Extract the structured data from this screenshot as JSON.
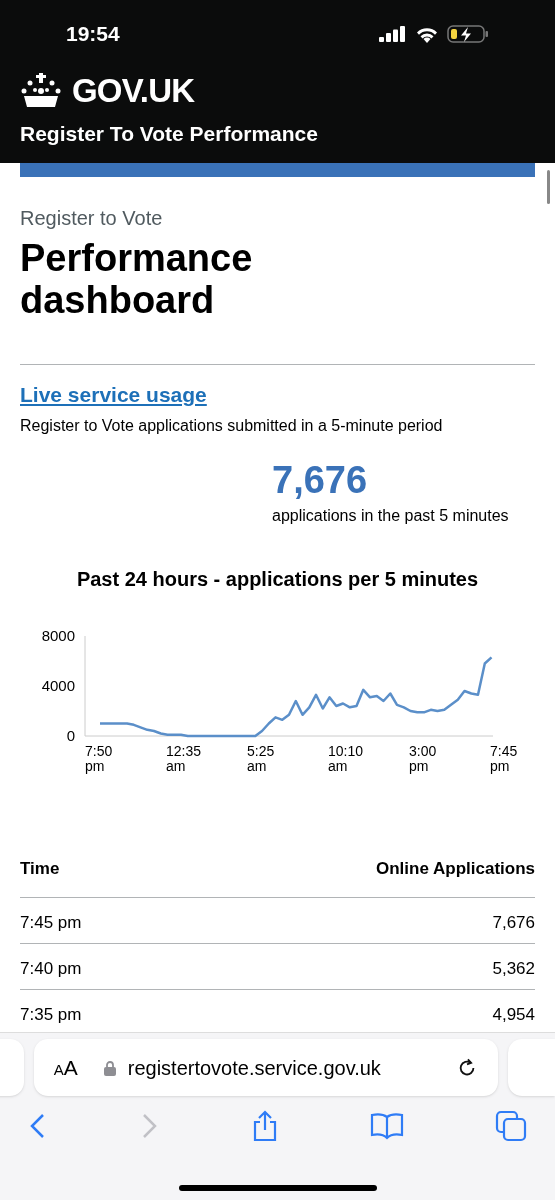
{
  "status_bar": {
    "time": "19:54"
  },
  "header": {
    "logo": "GOV.UK",
    "service": "Register To Vote Performance"
  },
  "page": {
    "caption": "Register to Vote",
    "title": "Performance dashboard"
  },
  "live": {
    "link": "Live service usage",
    "description": "Register to Vote applications submitted in a 5-minute period",
    "figure": "7,676",
    "figure_label": "applications in the past 5 minutes"
  },
  "chart": {
    "chart_data": {
      "type": "line",
      "title": "Past 24 hours - applications per 5 minutes",
      "ylim": [
        0,
        8000
      ],
      "yticks": [
        0,
        4000,
        8000
      ],
      "categories": [
        "7:50 pm",
        null,
        null,
        null,
        null,
        null,
        null,
        null,
        null,
        null,
        null,
        null,
        "12:35 am",
        null,
        null,
        null,
        null,
        null,
        null,
        null,
        null,
        null,
        null,
        null,
        "5:25 am",
        null,
        null,
        null,
        null,
        null,
        null,
        null,
        null,
        null,
        null,
        null,
        "10:10 am",
        null,
        null,
        null,
        null,
        null,
        null,
        null,
        null,
        null,
        null,
        null,
        "3:00 pm",
        null,
        null,
        null,
        null,
        null,
        null,
        null,
        null,
        null,
        null,
        null,
        "7:45 pm"
      ],
      "series": [
        {
          "color": "#5b8fc9",
          "values": [
            1000,
            1000,
            1000,
            1000,
            1000,
            900,
            700,
            500,
            400,
            200,
            100,
            100,
            100,
            0,
            0,
            0,
            0,
            0,
            0,
            0,
            0,
            0,
            0,
            0,
            400,
            1000,
            1500,
            1300,
            1700,
            2800,
            1700,
            2300,
            3300,
            2200,
            3100,
            2400,
            2600,
            2300,
            2400,
            3700,
            3100,
            3200,
            2800,
            3400,
            2500,
            2300,
            2000,
            1900,
            1900,
            2100,
            2000,
            2100,
            2500,
            2900,
            3600,
            3400,
            3300,
            5800,
            6300,
            null,
            null
          ]
        }
      ]
    }
  },
  "table": {
    "columns": [
      "Time",
      "Online Applications"
    ],
    "rows": [
      [
        "7:45 pm",
        "7,676"
      ],
      [
        "7:40 pm",
        "5,362"
      ],
      [
        "7:35 pm",
        "4,954"
      ]
    ]
  },
  "browser": {
    "text_size": "AA",
    "url": "registertovote.service.gov.uk"
  }
}
